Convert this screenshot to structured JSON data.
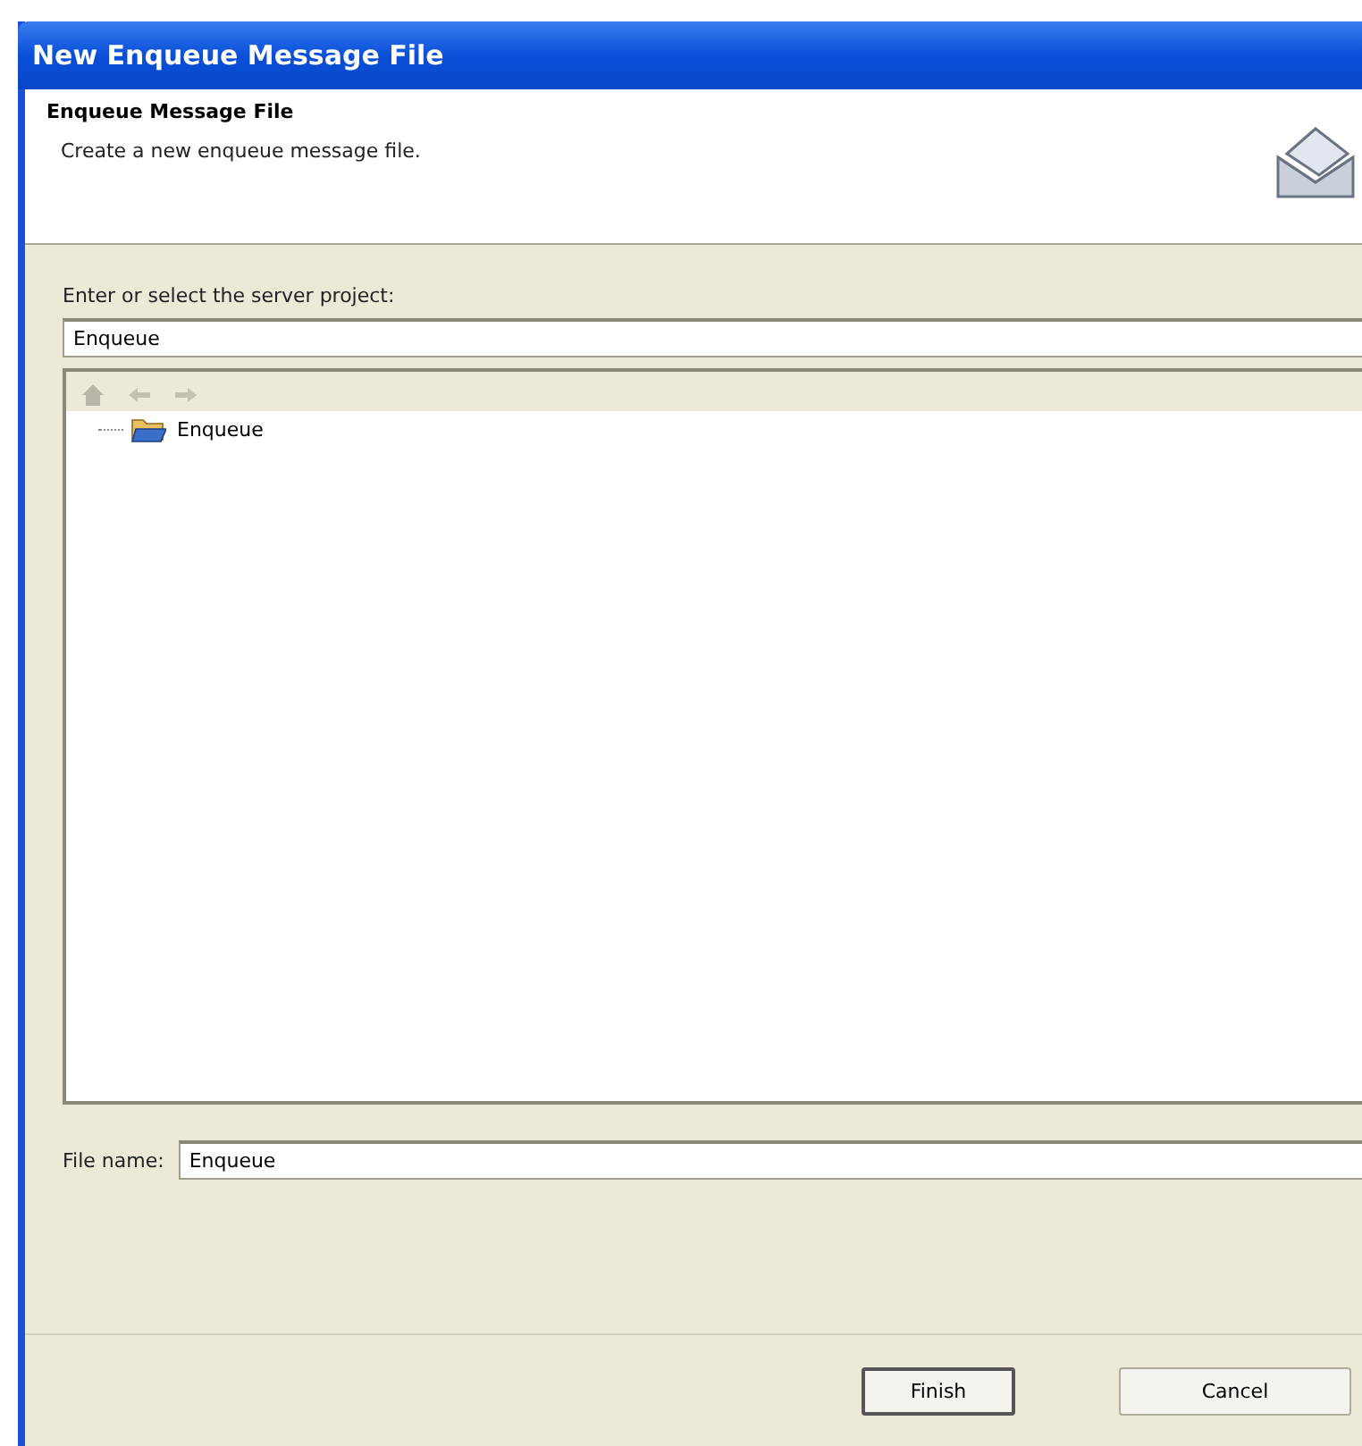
{
  "window": {
    "title": "New Enqueue Message File"
  },
  "header": {
    "title": "Enqueue Message File",
    "description": "Create a new enqueue message file."
  },
  "project": {
    "label": "Enter or select the server project:",
    "value": "Enqueue"
  },
  "tree": {
    "items": [
      {
        "label": "Enqueue",
        "selected": false
      }
    ]
  },
  "file_name": {
    "label": "File name:",
    "value": "Enqueue"
  },
  "buttons": [
    {
      "label": "Finish",
      "kind": "default"
    },
    {
      "label": "Cancel",
      "kind": "normal"
    }
  ]
}
